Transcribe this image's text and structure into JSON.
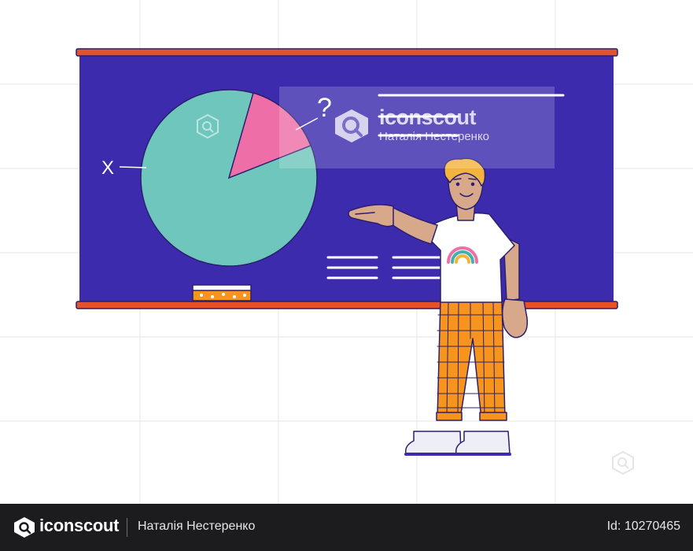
{
  "illustration": {
    "board_symbols": {
      "x_label": "X",
      "question_mark": "?"
    },
    "colors": {
      "board": "#3c2bad",
      "board_rail": "#e4512a",
      "pie_main": "#6fc6bd",
      "pie_slice": "#ee6fa8",
      "outline": "#2b1f6e",
      "skin": "#d7a88a",
      "hair": "#f3b43f",
      "pants": "#f7941d",
      "shoes": "#eeeef6",
      "rainbow_outer": "#ee6fa8",
      "rainbow_middle": "#3fb3ab",
      "rainbow_inner": "#f3b43f",
      "sponge": "#f7941d",
      "grid_lines": "#e5e5e5"
    },
    "pie_chart": {
      "slice_fraction": 0.14
    }
  },
  "watermark": {
    "brand": "iconscout",
    "author": "Наталія Нестеренко",
    "icon": "iconscout-logo-icon"
  },
  "footer": {
    "brand": "iconscout",
    "author": "Наталія Нестеренко",
    "asset_id": "Id: 10270465",
    "icon": "iconscout-logo-icon"
  }
}
